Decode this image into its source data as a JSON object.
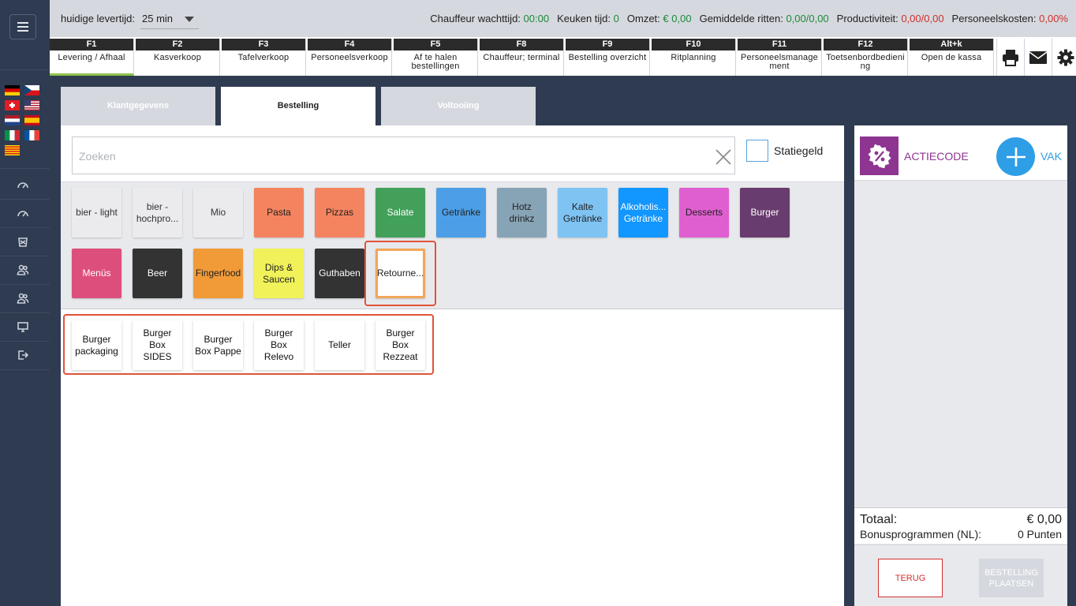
{
  "topbar": {
    "levertijd_label": "huidige levertijd:",
    "levertijd_value": "25 min",
    "chauffeur_label": "Chauffeur wachttijd:",
    "chauffeur_value": "00:00",
    "keuken_label": "Keuken tijd:",
    "keuken_value": "0",
    "omzet_label": "Omzet:",
    "omzet_value": "€ 0,00",
    "ritten_label": "Gemiddelde ritten:",
    "ritten_value": "0,00/0,00",
    "productiviteit_label": "Productiviteit:",
    "productiviteit_value": "0,00/0,00",
    "personeel_label": "Personeelskosten:",
    "personeel_value": "0,00%"
  },
  "fkeys": [
    {
      "key": "F1",
      "label": "Levering / Afhaal"
    },
    {
      "key": "F2",
      "label": "Kasverkoop"
    },
    {
      "key": "F3",
      "label": "Tafelverkoop"
    },
    {
      "key": "F4",
      "label": "Personeelsverkoop"
    },
    {
      "key": "F5",
      "label": "Af te halen bestellingen"
    },
    {
      "key": "F8",
      "label": "Chauffeur; terminal"
    },
    {
      "key": "F9",
      "label": "Bestelling overzicht"
    },
    {
      "key": "F10",
      "label": "Ritplanning"
    },
    {
      "key": "F11",
      "label": "Personeelsmanagement"
    },
    {
      "key": "F12",
      "label": "Toetsenbordbediening"
    },
    {
      "key": "Alt+k",
      "label": "Open de kassa"
    }
  ],
  "tabs": [
    {
      "label": "Klantgegevens"
    },
    {
      "label": "Bestelling"
    },
    {
      "label": "Voltooiing"
    }
  ],
  "search": {
    "placeholder": "Zoeken"
  },
  "statiegeld_label": "Statiegeld",
  "categories": [
    {
      "label": "bier - light",
      "bg": "#ebebee",
      "fg": "#333333"
    },
    {
      "label": "bier - hochpro...",
      "bg": "#ebebee",
      "fg": "#333333"
    },
    {
      "label": "Mio",
      "bg": "#ebebee",
      "fg": "#333333"
    },
    {
      "label": "Pasta",
      "bg": "#f4845f",
      "fg": "#222222"
    },
    {
      "label": "Pizzas",
      "bg": "#f4845f",
      "fg": "#222222"
    },
    {
      "label": "Salate",
      "bg": "#43a05a",
      "fg": "#ffffff"
    },
    {
      "label": "Getränke",
      "bg": "#4c9fe6",
      "fg": "#222222"
    },
    {
      "label": "Hotz drinkz",
      "bg": "#87a4b6",
      "fg": "#222222"
    },
    {
      "label": "Kalte Getränke",
      "bg": "#7fc3f3",
      "fg": "#222222"
    },
    {
      "label": "Alkoholis... Getränke",
      "bg": "#1296ff",
      "fg": "#ffffff"
    },
    {
      "label": "Desserts",
      "bg": "#e05fd0",
      "fg": "#222222"
    },
    {
      "label": "Burger",
      "bg": "#693c6f",
      "fg": "#ffffff"
    },
    {
      "label": "Menüs",
      "bg": "#dc4f7c",
      "fg": "#ffffff"
    },
    {
      "label": "Beer",
      "bg": "#333333",
      "fg": "#ffffff"
    },
    {
      "label": "Fingerfood",
      "bg": "#f19a38",
      "fg": "#222222"
    },
    {
      "label": "Dips & Saucen",
      "bg": "#f1f259",
      "fg": "#222222"
    },
    {
      "label": "Guthaben",
      "bg": "#333333",
      "fg": "#ffffff"
    },
    {
      "label": "Retourne...",
      "bg": "#ffffff",
      "fg": "#222222"
    }
  ],
  "products": [
    {
      "label": "Burger packaging"
    },
    {
      "label": "Burger Box SIDES"
    },
    {
      "label": "Burger Box Pappe"
    },
    {
      "label": "Burger Box Relevo"
    },
    {
      "label": "Teller"
    },
    {
      "label": "Burger Box Rezzeat"
    }
  ],
  "right": {
    "actiecode_label": "ACTIECODE",
    "vak_label": "VAK",
    "totaal_label": "Totaal:",
    "totaal_value": "€ 0,00",
    "bonus_label": "Bonusprogrammen (NL):",
    "bonus_value": "0 Punten",
    "terug_label": "TERUG",
    "bestelling_label": "BESTELLING PLAATSEN"
  },
  "colors": {
    "sidebar": "#2f3b50",
    "accent_green": "#8bc34a",
    "actie_purple": "#8e3591",
    "vak_blue": "#2e9ee6",
    "highlight_red": "#e0533a"
  }
}
